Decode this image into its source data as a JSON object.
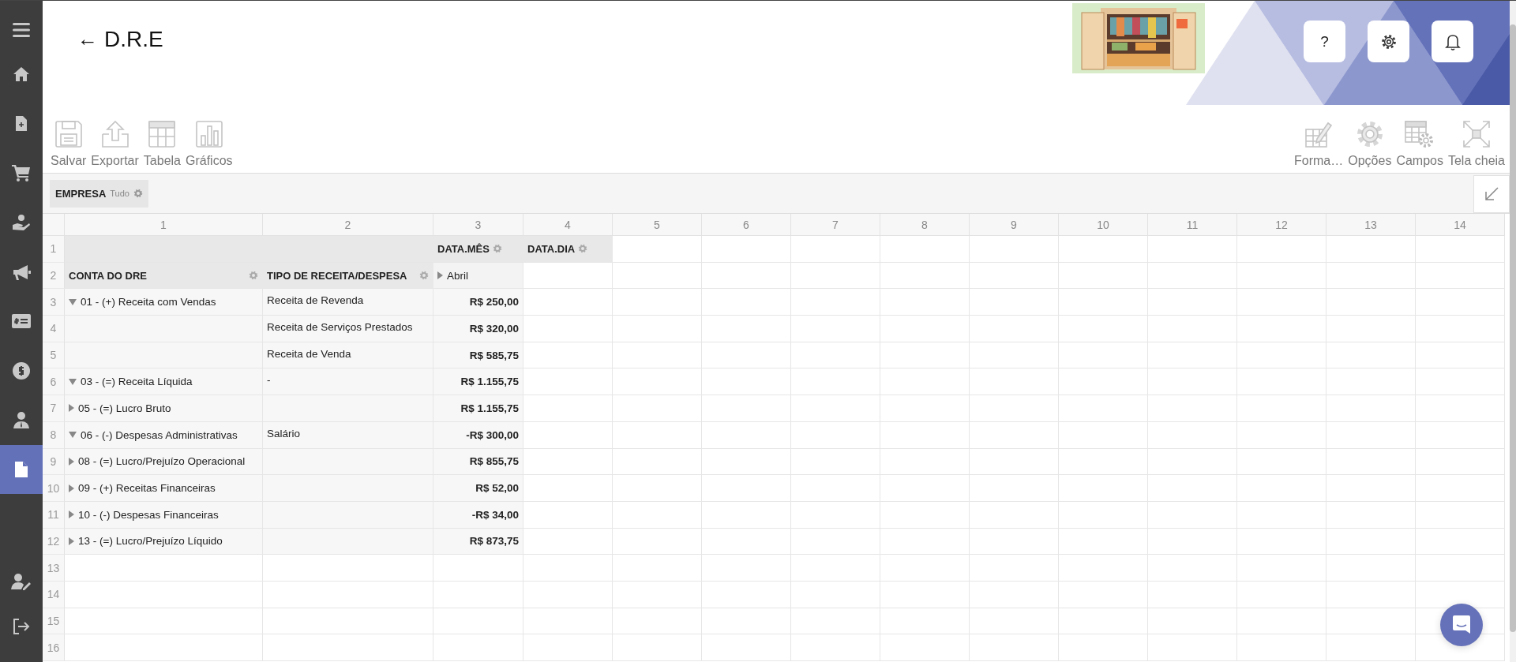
{
  "sidebar": {
    "items": [
      {
        "kind": "menu",
        "selected": false
      },
      {
        "kind": "home",
        "selected": false
      },
      {
        "kind": "file-add",
        "selected": false
      },
      {
        "kind": "cart",
        "selected": false
      },
      {
        "kind": "hand",
        "selected": false
      },
      {
        "kind": "megaphone",
        "selected": false
      },
      {
        "kind": "card",
        "selected": false
      },
      {
        "kind": "dollar",
        "selected": false
      },
      {
        "kind": "person",
        "selected": false
      },
      {
        "kind": "document",
        "selected": true
      }
    ],
    "bottom_items": [
      {
        "kind": "user-edit",
        "selected": false
      },
      {
        "kind": "logout",
        "selected": false
      }
    ]
  },
  "header": {
    "back": "←",
    "title": "D.R.E",
    "buttons": [
      {
        "kind": "help",
        "label": "?"
      },
      {
        "kind": "settings"
      },
      {
        "kind": "notifications"
      }
    ]
  },
  "toolbar": {
    "left": [
      {
        "kind": "save",
        "label": "Salvar"
      },
      {
        "kind": "export",
        "label": "Exportar"
      },
      {
        "kind": "table",
        "label": "Tabela"
      },
      {
        "kind": "charts",
        "label": "Gráficos"
      }
    ],
    "right": [
      {
        "kind": "format",
        "label": "Forma…"
      },
      {
        "kind": "options",
        "label": "Opções"
      },
      {
        "kind": "fields",
        "label": "Campos"
      },
      {
        "kind": "fullscreen",
        "label": "Tela cheia"
      }
    ]
  },
  "filters": [
    {
      "field": "EMPRESA",
      "value": "Tudo"
    }
  ],
  "grid": {
    "column_numbers": [
      "1",
      "2",
      "3",
      "4",
      "5",
      "6",
      "7",
      "8",
      "9",
      "10",
      "11",
      "12",
      "13",
      "14"
    ],
    "field_row": {
      "number": "1",
      "columns": [
        "DATA.MÊS",
        "DATA.DIA"
      ]
    },
    "header_row": {
      "number": "2",
      "row_fields": [
        "CONTA DO DRE",
        "TIPO DE RECEITA/DESPESA"
      ],
      "column_value": {
        "label": "Abril",
        "expanded": false
      }
    },
    "data_rows": [
      {
        "number": "3",
        "account": {
          "label": "01 - (+) Receita com Vendas",
          "expanded": true
        },
        "type": "Receita de Revenda",
        "value": "R$ 250,00"
      },
      {
        "number": "4",
        "type": "Receita de Serviços Prestados",
        "value": "R$ 320,00"
      },
      {
        "number": "5",
        "type": "Receita de Venda",
        "value": "R$ 585,75"
      },
      {
        "number": "6",
        "account": {
          "label": "03 - (=) Receita Líquida",
          "expanded": true
        },
        "type": "-",
        "value": "R$ 1.155,75"
      },
      {
        "number": "7",
        "account": {
          "label": "05 - (=) Lucro Bruto",
          "expanded": false
        },
        "value": "R$ 1.155,75"
      },
      {
        "number": "8",
        "account": {
          "label": "06 - (-) Despesas Administrativas",
          "expanded": true
        },
        "type": "Salário",
        "value": "-R$ 300,00"
      },
      {
        "number": "9",
        "account": {
          "label": "08 - (=) Lucro/Prejuízo Operacional",
          "expanded": false
        },
        "value": "R$ 855,75"
      },
      {
        "number": "10",
        "account": {
          "label": "09 - (+) Receitas Financeiras",
          "expanded": false
        },
        "value": "R$ 52,00"
      },
      {
        "number": "11",
        "account": {
          "label": "10 - (-) Despesas Financeiras",
          "expanded": false
        },
        "value": "-R$ 34,00"
      },
      {
        "number": "12",
        "account": {
          "label": "13 - (=) Lucro/Prejuízo Líquido",
          "expanded": false
        },
        "value": "R$ 873,75"
      }
    ],
    "empty_rows": [
      "13",
      "14",
      "15",
      "16"
    ]
  }
}
